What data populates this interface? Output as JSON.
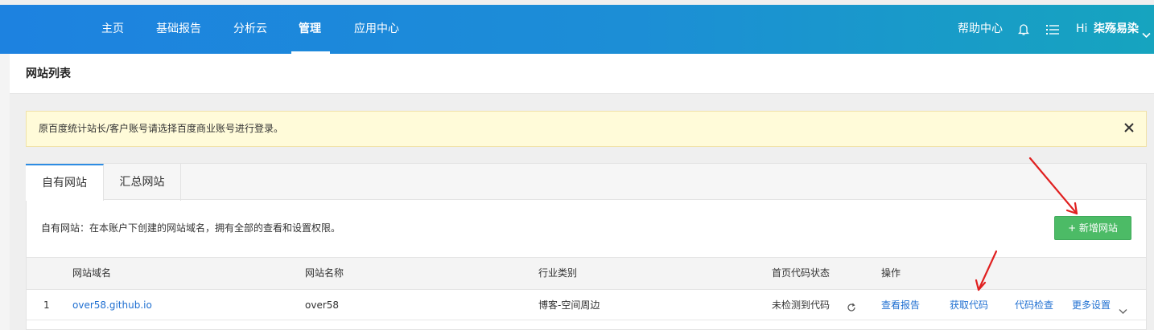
{
  "nav": {
    "items": [
      {
        "label": "主页",
        "active": false
      },
      {
        "label": "基础报告",
        "active": false
      },
      {
        "label": "分析云",
        "active": false
      },
      {
        "label": "管理",
        "active": true
      },
      {
        "label": "应用中心",
        "active": false
      }
    ],
    "help": "帮助中心",
    "greeting": "Hi",
    "username": "柒殇易染",
    "icons": [
      "bell-icon",
      "list-icon",
      "chevron-down-icon"
    ]
  },
  "page": {
    "title": "网站列表"
  },
  "notice": {
    "text": "原百度统计站长/客户账号请选择百度商业账号进行登录。",
    "close_icon": "close-icon",
    "bg_color": "#fffbd9"
  },
  "tabs": [
    {
      "label": "自有网站",
      "active": true
    },
    {
      "label": "汇总网站",
      "active": false
    }
  ],
  "description": "自有网站：在本账户下创建的网站域名，拥有全部的查看和设置权限。",
  "add_button": {
    "label": "+ 新增网站",
    "color": "#4cbb66"
  },
  "table": {
    "headers": [
      "网站域名",
      "网站名称",
      "行业类别",
      "首页代码状态",
      "操作"
    ],
    "rows": [
      {
        "index": "1",
        "domain": "over58.github.io",
        "name": "over58",
        "category": "博客-空间周边",
        "status": "未检测到代码",
        "status_icon": "refresh-icon",
        "actions": [
          "查看报告",
          "获取代码",
          "代码检查",
          "更多设置"
        ],
        "more_icon": "chevron-down-icon"
      }
    ]
  },
  "colors": {
    "brand_start": "#1d82e0",
    "brand_end": "#16a4bf",
    "link": "#1f6fd1",
    "annotation": "#e02020"
  }
}
